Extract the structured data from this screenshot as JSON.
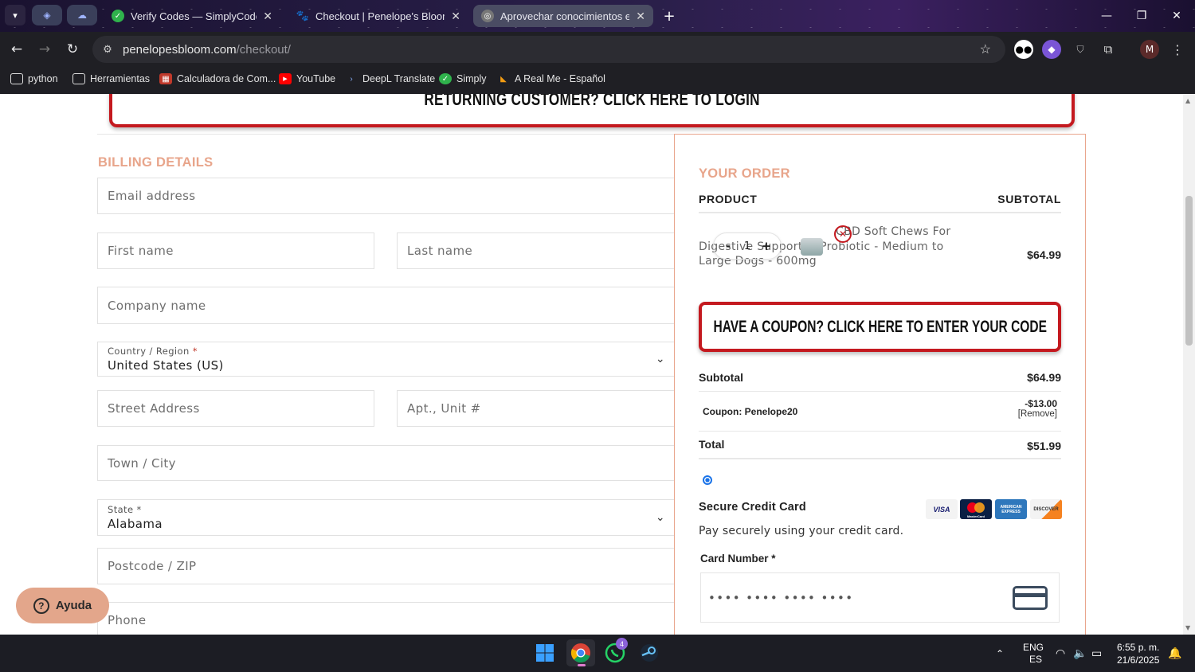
{
  "browser": {
    "tabs": [
      {
        "label": "Verify Codes — SimplyCodes",
        "active": false
      },
      {
        "label": "Checkout | Penelope's Bloom",
        "active": false
      },
      {
        "label": "Aprovechar conocimientos en I",
        "active": true
      }
    ],
    "url_host": "penelopesbloom.com",
    "url_path": "/checkout/",
    "profile_initial": "M",
    "bookmarks": [
      "python",
      "Herramientas",
      "Calculadora de Com...",
      "YouTube",
      "DeepL Translate",
      "Simply",
      "A Real Me - Español"
    ]
  },
  "page": {
    "returning_banner": "Returning customer? Click here to login",
    "billing_title": "BILLING DETAILS",
    "fields": {
      "email": "Email address",
      "first_name": "First name",
      "last_name": "Last name",
      "company": "Company name",
      "country_label": "Country / Region",
      "country_value": "United States (US)",
      "street": "Street Address",
      "apt": "Apt., Unit #",
      "city": "Town / City",
      "state_label": "State",
      "state_value": "Alabama",
      "postcode": "Postcode / ZIP",
      "phone": "Phone"
    },
    "required_mark": "*",
    "help_button": "Ayuda"
  },
  "order": {
    "title": "YOUR ORDER",
    "col_product": "PRODUCT",
    "col_subtotal": "SUBTOTAL",
    "item": {
      "quantity": "1",
      "minus": "-",
      "plus": "+",
      "name": "CBD Soft Chews For Digestive Support + Probiotic - Medium to Large Dogs - 600mg",
      "price": "$64.99"
    },
    "coupon_banner": "Have a coupon? Click here to enter your code",
    "subtotal_label": "Subtotal",
    "subtotal_value": "$64.99",
    "coupon_label": "Coupon: Penelope20",
    "coupon_value": "-$13.00",
    "coupon_remove": "[Remove]",
    "total_label": "Total",
    "total_value": "$51.99",
    "payment_method": "Secure Credit Card",
    "payment_desc": "Pay securely using your credit card.",
    "card_logos": [
      "VISA",
      "MasterCard",
      "AMERICAN EXPRESS",
      "DISCOVER"
    ],
    "card_number_label": "Card Number",
    "card_number_placeholder": "•••• •••• •••• ••••"
  },
  "taskbar": {
    "lang_top": "ENG",
    "lang_bottom": "ES",
    "time": "6:55 p. m.",
    "date": "21/6/2025",
    "whatsapp_badge": "4"
  },
  "colors": {
    "accent_salmon": "#e8a58b",
    "brand_red": "#c4191f",
    "link_blue": "#1a73e8"
  }
}
